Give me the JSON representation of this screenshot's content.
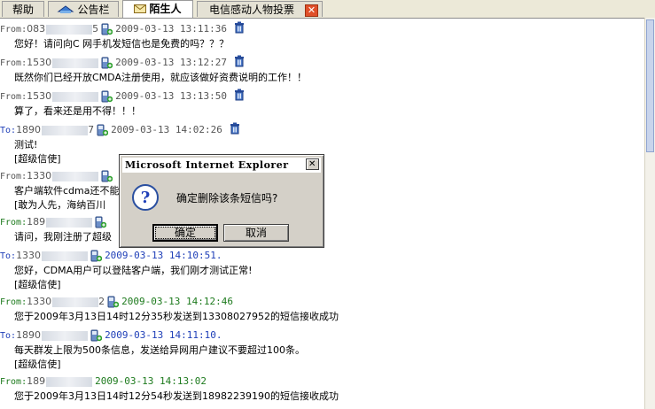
{
  "tabs": [
    {
      "label": "帮助"
    },
    {
      "label": "公告栏"
    },
    {
      "label": "陌生人"
    },
    {
      "label": "电信感动人物投票"
    }
  ],
  "tab_close": "✕",
  "messages": [
    {
      "dir": "From:",
      "num": "083",
      "num_tail": "5",
      "time": "2009-03-13 13:11:36",
      "lines": [
        "您好！请问向C 网手机发短信也是免费的吗？？？"
      ]
    },
    {
      "dir": "From:",
      "num": "1530",
      "num_tail": "",
      "time": "2009-03-13 13:12:27",
      "lines": [
        "既然你们已经开放CMDA注册使用，就应该做好资费说明的工作！！"
      ]
    },
    {
      "dir": "From:",
      "num": "1530",
      "num_tail": "",
      "time": "2009-03-13 13:13:50",
      "lines": [
        "算了，看来还是用不得！！！"
      ]
    },
    {
      "dir": "To:",
      "num": "1890",
      "num_tail": "7",
      "time": "2009-03-13 14:02:26",
      "lines": [
        "测试!",
        "[超级信使]"
      ]
    },
    {
      "dir": "From:",
      "num": "1330",
      "num_tail": "",
      "time": "",
      "lines": [
        "客户端软件cdma还不能",
        "[敢为人先，海纳百川"
      ]
    },
    {
      "dir": "From:",
      "num": "189",
      "num_tail": "",
      "time": "",
      "lines": [
        "请问，我刚注册了超级"
      ]
    },
    {
      "dir": "To:",
      "num": "1330",
      "num_tail": "",
      "time": "2009-03-13 14:10:51.",
      "lines": [
        "您好，CDMA用户可以登陆客户端，我们刚才测试正常!",
        "[超级信使]"
      ]
    },
    {
      "dir": "From:",
      "num": "1330",
      "num_tail": "2",
      "time": "2009-03-13 14:12:46",
      "lines": [
        "您于2009年3月13日14时12分35秒发送到13308027952的短信接收成功"
      ]
    },
    {
      "dir": "To:",
      "num": "1890",
      "num_tail": "",
      "time": "2009-03-13 14:11:10.",
      "lines": [
        "每天群发上限为500条信息，发送给异网用户建议不要超过100条。",
        "[超级信使]"
      ]
    },
    {
      "dir": "From:",
      "num": "189",
      "num_tail": "",
      "time": "2009-03-13 14:13:02",
      "lines": [
        "您于2009年3月13日14时12分54秒发送到18982239190的短信接收成功"
      ]
    }
  ],
  "dialog": {
    "title": "Microsoft Internet Explorer",
    "close": "✕",
    "message": "确定删除该条短信吗?",
    "ok": "确定",
    "cancel": "取消"
  }
}
